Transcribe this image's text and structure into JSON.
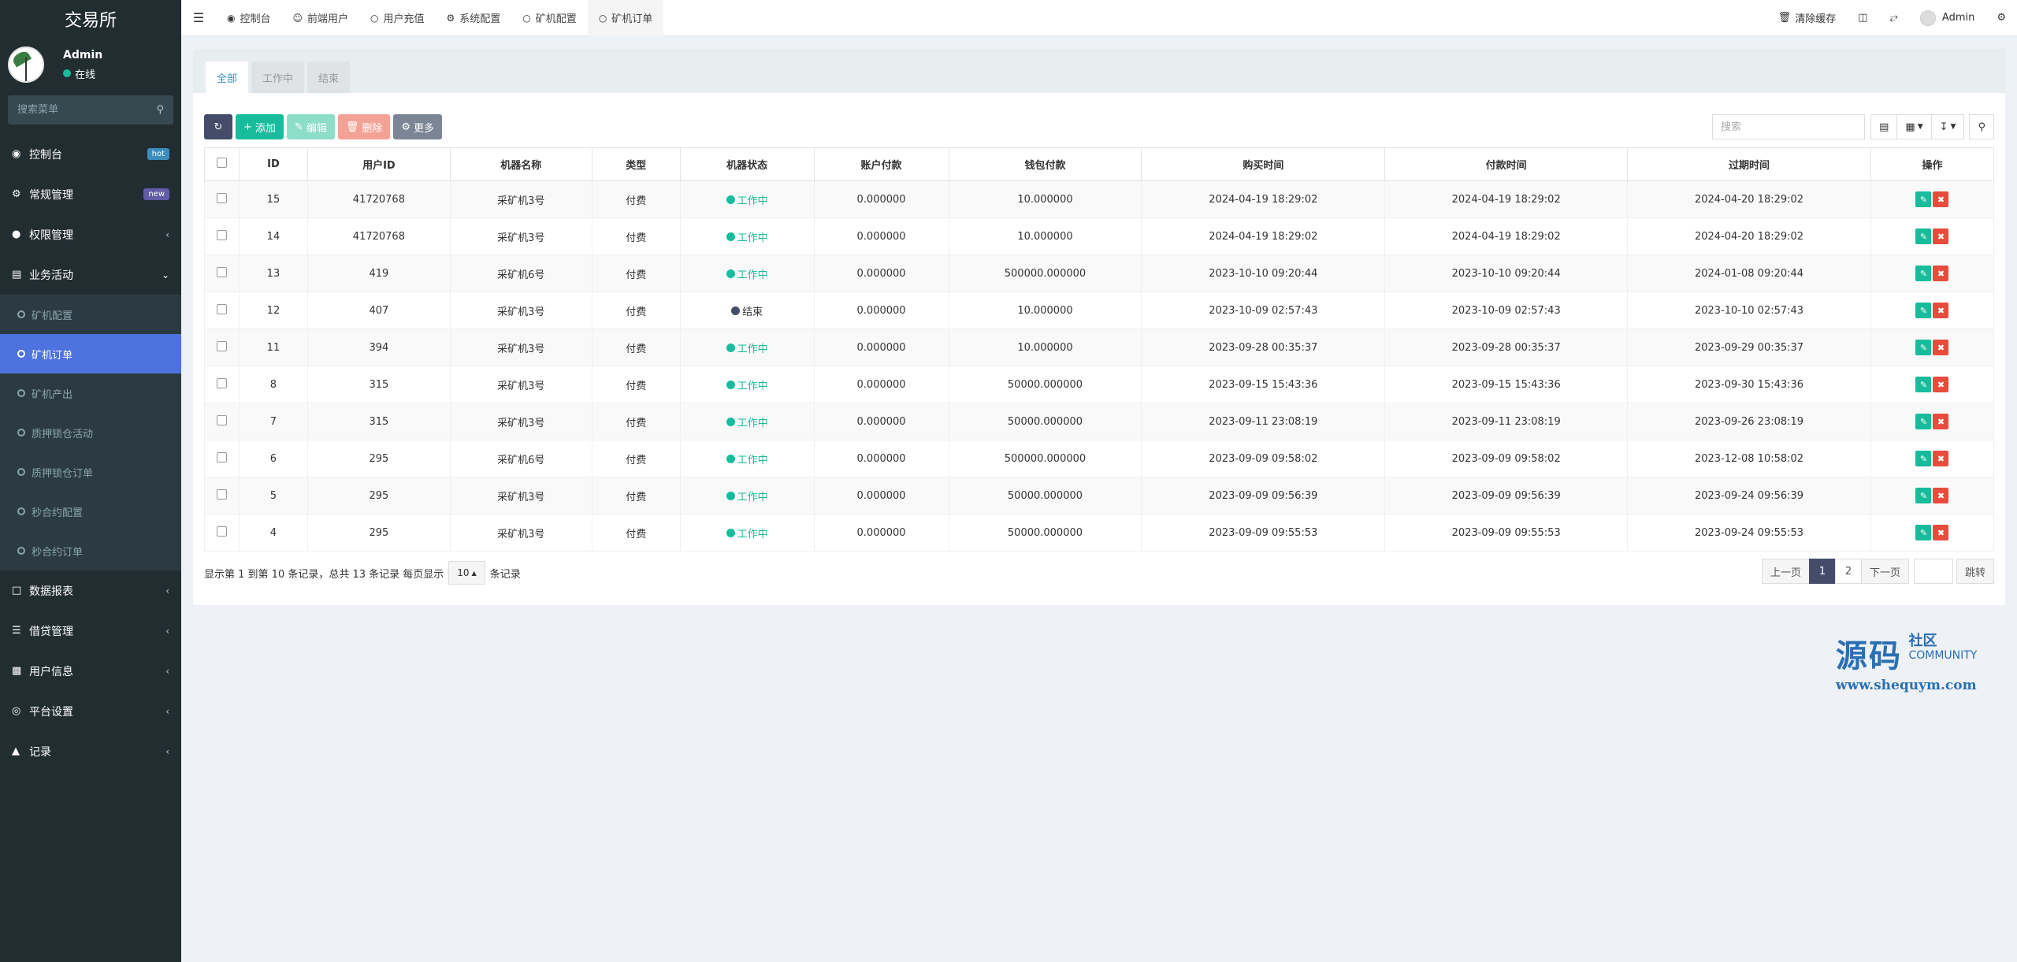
{
  "app": {
    "brand": "交易所"
  },
  "user": {
    "name": "Admin",
    "status": "在线"
  },
  "sidebar": {
    "search_placeholder": "搜索菜单",
    "items": [
      {
        "label": "控制台",
        "icon": "dashboard-icon",
        "badge": "hot"
      },
      {
        "label": "常规管理",
        "icon": "cogs-icon",
        "badge": "new"
      },
      {
        "label": "权限管理",
        "icon": "users-icon"
      },
      {
        "label": "业务活动",
        "icon": "list-icon",
        "expanded": true
      },
      {
        "label": "数据报表",
        "icon": "file-icon"
      },
      {
        "label": "借贷管理",
        "icon": "table-icon"
      },
      {
        "label": "用户信息",
        "icon": "id-card-icon"
      },
      {
        "label": "平台设置",
        "icon": "settings-icon"
      },
      {
        "label": "记录",
        "icon": "chart-icon"
      }
    ],
    "sub_items": [
      "矿机配置",
      "矿机订单",
      "矿机产出",
      "质押锁仓活动",
      "质押锁仓订单",
      "秒合约配置",
      "秒合约订单"
    ],
    "active_sub": "矿机订单"
  },
  "navbar": {
    "tabs": [
      {
        "label": "控制台",
        "icon": "dashboard-icon"
      },
      {
        "label": "前端用户",
        "icon": "user-icon"
      },
      {
        "label": "用户充值",
        "icon": "circle-icon"
      },
      {
        "label": "系统配置",
        "icon": "gear-icon"
      },
      {
        "label": "矿机配置",
        "icon": "circle-icon"
      },
      {
        "label": "矿机订单",
        "icon": "circle-icon",
        "active": true
      }
    ],
    "clear_cache": "清除缓存",
    "admin_name": "Admin"
  },
  "content_tabs": [
    "全部",
    "工作中",
    "结束"
  ],
  "toolbar": {
    "add": "添加",
    "edit": "编辑",
    "delete": "删除",
    "more": "更多",
    "search_placeholder": "搜索"
  },
  "table": {
    "headers": [
      "ID",
      "用户ID",
      "机器名称",
      "类型",
      "机器状态",
      "账户付款",
      "钱包付款",
      "购买时间",
      "付款时间",
      "过期时间",
      "操作"
    ],
    "rows": [
      {
        "id": "15",
        "uid": "41720768",
        "name": "采矿机3号",
        "type": "付费",
        "status": "工作中",
        "active": true,
        "acct": "0.000000",
        "wallet": "10.000000",
        "buy": "2024-04-19 18:29:02",
        "pay": "2024-04-19 18:29:02",
        "exp": "2024-04-20 18:29:02"
      },
      {
        "id": "14",
        "uid": "41720768",
        "name": "采矿机3号",
        "type": "付费",
        "status": "工作中",
        "active": true,
        "acct": "0.000000",
        "wallet": "10.000000",
        "buy": "2024-04-19 18:29:02",
        "pay": "2024-04-19 18:29:02",
        "exp": "2024-04-20 18:29:02"
      },
      {
        "id": "13",
        "uid": "419",
        "name": "采矿机6号",
        "type": "付费",
        "status": "工作中",
        "active": true,
        "acct": "0.000000",
        "wallet": "500000.000000",
        "buy": "2023-10-10 09:20:44",
        "pay": "2023-10-10 09:20:44",
        "exp": "2024-01-08 09:20:44"
      },
      {
        "id": "12",
        "uid": "407",
        "name": "采矿机3号",
        "type": "付费",
        "status": "结束",
        "active": false,
        "acct": "0.000000",
        "wallet": "10.000000",
        "buy": "2023-10-09 02:57:43",
        "pay": "2023-10-09 02:57:43",
        "exp": "2023-10-10 02:57:43"
      },
      {
        "id": "11",
        "uid": "394",
        "name": "采矿机3号",
        "type": "付费",
        "status": "工作中",
        "active": true,
        "acct": "0.000000",
        "wallet": "10.000000",
        "buy": "2023-09-28 00:35:37",
        "pay": "2023-09-28 00:35:37",
        "exp": "2023-09-29 00:35:37"
      },
      {
        "id": "8",
        "uid": "315",
        "name": "采矿机3号",
        "type": "付费",
        "status": "工作中",
        "active": true,
        "acct": "0.000000",
        "wallet": "50000.000000",
        "buy": "2023-09-15 15:43:36",
        "pay": "2023-09-15 15:43:36",
        "exp": "2023-09-30 15:43:36"
      },
      {
        "id": "7",
        "uid": "315",
        "name": "采矿机3号",
        "type": "付费",
        "status": "工作中",
        "active": true,
        "acct": "0.000000",
        "wallet": "50000.000000",
        "buy": "2023-09-11 23:08:19",
        "pay": "2023-09-11 23:08:19",
        "exp": "2023-09-26 23:08:19"
      },
      {
        "id": "6",
        "uid": "295",
        "name": "采矿机6号",
        "type": "付费",
        "status": "工作中",
        "active": true,
        "acct": "0.000000",
        "wallet": "500000.000000",
        "buy": "2023-09-09 09:58:02",
        "pay": "2023-09-09 09:58:02",
        "exp": "2023-12-08 10:58:02"
      },
      {
        "id": "5",
        "uid": "295",
        "name": "采矿机3号",
        "type": "付费",
        "status": "工作中",
        "active": true,
        "acct": "0.000000",
        "wallet": "50000.000000",
        "buy": "2023-09-09 09:56:39",
        "pay": "2023-09-09 09:56:39",
        "exp": "2023-09-24 09:56:39"
      },
      {
        "id": "4",
        "uid": "295",
        "name": "采矿机3号",
        "type": "付费",
        "status": "工作中",
        "active": true,
        "acct": "0.000000",
        "wallet": "50000.000000",
        "buy": "2023-09-09 09:55:53",
        "pay": "2023-09-09 09:55:53",
        "exp": "2023-09-24 09:55:53"
      }
    ]
  },
  "pager": {
    "info": "显示第 1 到第 10 条记录，总共 13 条记录 每页显示",
    "page_size": "10",
    "suffix": "条记录",
    "prev": "上一页",
    "pages": [
      "1",
      "2"
    ],
    "next": "下一页",
    "jump": "跳转"
  },
  "watermark": {
    "big": "源码",
    "small": "社区",
    "community": "COMMUNITY",
    "url": "www.shequym.com"
  },
  "colors": {
    "sidebar_bg": "#222d32",
    "active_menu": "#4e73df",
    "accent_green": "#18bc9c",
    "danger": "#e74c3c",
    "dark_button": "#444c69"
  }
}
